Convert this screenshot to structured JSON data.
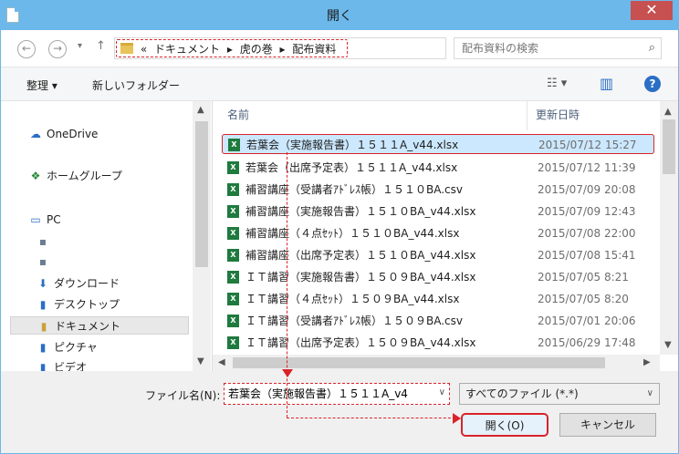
{
  "window": {
    "title": "開く",
    "close_glyph": "✕"
  },
  "nav": {
    "back": "←",
    "forward": "→",
    "up": "↑"
  },
  "address": {
    "crumbs": [
      "«",
      "ドキュメント",
      "▸",
      "虎の巻",
      "▸",
      "配布資料"
    ],
    "dropdown": "∨",
    "refresh": "↻"
  },
  "search": {
    "placeholder": "配布資料の検索",
    "icon": "⌕"
  },
  "toolbar": {
    "organize": "整理 ▾",
    "new_folder": "新しいフォルダー",
    "help": "?"
  },
  "navpane": {
    "items": [
      {
        "label": "OneDrive",
        "icon": "☁"
      },
      {
        "label": "ホームグループ",
        "icon": "❖"
      },
      {
        "label": "PC",
        "icon": "▭"
      },
      {
        "label": "",
        "icon": "▪"
      },
      {
        "label": "",
        "icon": "▪"
      },
      {
        "label": "ダウンロード",
        "icon": "⬇"
      },
      {
        "label": "デスクトップ",
        "icon": "▮"
      },
      {
        "label": "ドキュメント",
        "icon": "▮"
      },
      {
        "label": "ピクチャ",
        "icon": "▮"
      },
      {
        "label": "ビデオ",
        "icon": "▮"
      }
    ]
  },
  "files": {
    "columns": {
      "name": "名前",
      "date": "更新日時"
    },
    "rows": [
      {
        "name": "若葉会（実施報告書）１５１１A_v44.xlsx",
        "date": "2015/07/12 15:27",
        "type": "xlsx"
      },
      {
        "name": "若葉会（出席予定表）１５１１A_v44.xlsx",
        "date": "2015/07/12 11:39",
        "type": "xlsx"
      },
      {
        "name": "補習講座（受講者ｱﾄﾞﾚｽ帳）１５１０BA.csv",
        "date": "2015/07/09 20:08",
        "type": "csv"
      },
      {
        "name": "補習講座（実施報告書）１５１０BA_v44.xlsx",
        "date": "2015/07/09 12:43",
        "type": "xlsx"
      },
      {
        "name": "補習講座（４点ｾｯﾄ）１５１０BA_v44.xlsx",
        "date": "2015/07/08 22:00",
        "type": "xlsx"
      },
      {
        "name": "補習講座（出席予定表）１５１０BA_v44.xlsx",
        "date": "2015/07/08 15:41",
        "type": "xlsx"
      },
      {
        "name": "ＩＴ講習（実施報告書）１５０９BA_v44.xlsx",
        "date": "2015/07/05 8:21",
        "type": "xlsx"
      },
      {
        "name": "ＩＴ講習（４点ｾｯﾄ）１５０９BA_v44.xlsx",
        "date": "2015/07/05 8:20",
        "type": "xlsx"
      },
      {
        "name": "ＩＴ講習（受講者ｱﾄﾞﾚｽ帳）１５０９BA.csv",
        "date": "2015/07/01 20:06",
        "type": "csv"
      },
      {
        "name": "ＩＴ講習（出席予定表）１５０９BA_v44.xlsx",
        "date": "2015/06/29 17:48",
        "type": "xlsx"
      }
    ],
    "selected_index": 0
  },
  "bottom": {
    "filename_label": "ファイル名(N):",
    "filename_value": "若葉会（実施報告書）１５１１A_v4",
    "filter": "すべてのファイル (*.*)",
    "open_button": "開く(O)",
    "cancel_button": "キャンセル"
  },
  "colors": {
    "titlebar": "#6cb8ea",
    "close": "#c75050",
    "highlight": "#d9232a",
    "selection": "#cce8ff",
    "excel": "#1f7a3e"
  }
}
